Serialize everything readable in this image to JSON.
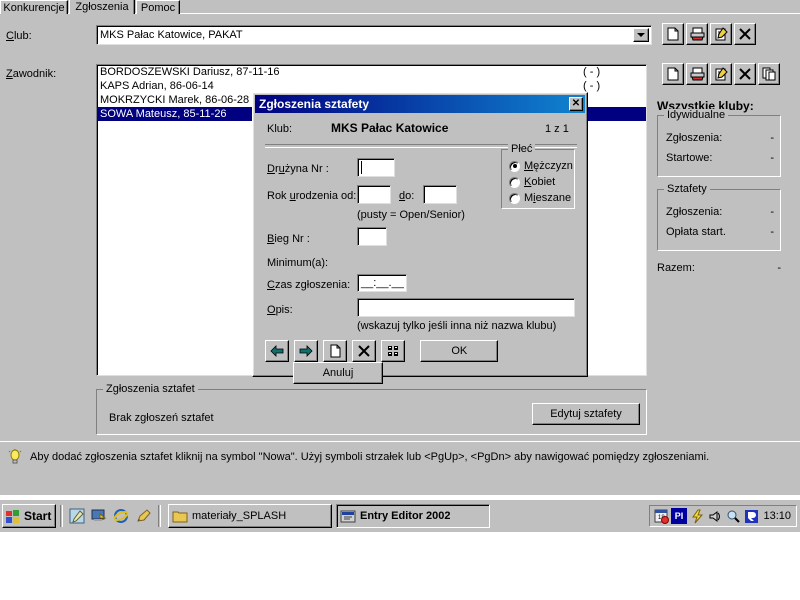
{
  "window": {
    "tabs": [
      {
        "label": "Konkurencje",
        "active": false
      },
      {
        "label": "Zgłoszenia",
        "active": true
      },
      {
        "label": "Pomoc",
        "active": false
      }
    ]
  },
  "form": {
    "club_label": "Club:",
    "club_value": "MKS Pałac Katowice,  PAKAT",
    "athlete_label": "Zawodnik:",
    "athletes": [
      {
        "name": "BORDOSZEWSKI Dariusz, 87-11-16",
        "mark": "( - )",
        "selected": false
      },
      {
        "name": "KAPS Adrian, 86-06-14",
        "mark": "( - )",
        "selected": false
      },
      {
        "name": "MOKRZYCKI Marek, 86-06-28",
        "mark": "",
        "selected": false
      },
      {
        "name": "SOWA Mateusz, 85-11-26",
        "mark": "",
        "selected": true
      }
    ]
  },
  "relay_section": {
    "group_title": "Zgłoszenia sztafet",
    "empty_text": "Brak zgłoszeń sztafet",
    "edit_button": "Edytuj sztafety"
  },
  "toolbar_top": [
    {
      "name": "new-icon",
      "title": "Nowa"
    },
    {
      "name": "print-icon",
      "title": "Drukuj"
    },
    {
      "name": "edit-icon",
      "title": "Edytuj"
    },
    {
      "name": "delete-icon",
      "title": "Usuń"
    }
  ],
  "toolbar_second": [
    {
      "name": "new-icon",
      "title": "Nowa"
    },
    {
      "name": "print-icon",
      "title": "Drukuj"
    },
    {
      "name": "edit-icon",
      "title": "Edytuj"
    },
    {
      "name": "delete-icon",
      "title": "Usuń"
    },
    {
      "name": "copy-icon",
      "title": "Kopiuj"
    }
  ],
  "side_panel": {
    "title": "Wszystkie kluby:",
    "individual": {
      "group_title": "Idywidualne",
      "rows": [
        {
          "label": "Zgłoszenia:",
          "value": "-"
        },
        {
          "label": "Startowe:",
          "value": "-"
        }
      ]
    },
    "relays": {
      "group_title": "Sztafety",
      "rows": [
        {
          "label": "Zgłoszenia:",
          "value": "-"
        },
        {
          "label": "Opłata start.",
          "value": "-"
        }
      ]
    },
    "total": {
      "label": "Razem:",
      "value": "-"
    }
  },
  "statusbar": {
    "icon": "lightbulb-icon",
    "text": "Aby dodać zgłoszenia sztafet kliknij na symbol \"Nowa\". Użyj symboli strzałek lub <PgUp>, <PgDn> aby nawigować pomiędzy zgłoszeniami."
  },
  "dialog": {
    "title": "Zgłoszenia sztafety",
    "close_label": "✕",
    "club_label": "Klub:",
    "club_value": "MKS Pałac Katowice",
    "counter": "1 z 1",
    "team_label": "Drużyna Nr :",
    "team_value": "",
    "birth_label": "Rok urodzenia od:",
    "birth_from": "",
    "birth_to_label": "do:",
    "birth_to": "",
    "birth_hint": "(pusty = Open/Senior)",
    "heat_label": "Bieg Nr :",
    "heat_value": "",
    "minimum_label": "Minimum(a):",
    "time_label": "Czas zgłoszenia:",
    "time_value": "__:__.__",
    "desc_label": "Opis:",
    "desc_value": "",
    "desc_hint": "(wskazuj tylko jeśli inna niż nazwa klubu)",
    "sex": {
      "group_title": "Płeć",
      "options": [
        {
          "label": "Mężczyzn",
          "selected": true
        },
        {
          "label": "Kobiet",
          "selected": false
        },
        {
          "label": "Mieszane",
          "selected": false
        }
      ]
    },
    "nav_buttons": [
      {
        "name": "previous-record-icon"
      },
      {
        "name": "next-record-icon"
      },
      {
        "name": "new-record-icon"
      },
      {
        "name": "delete-record-icon"
      },
      {
        "name": "team-members-icon"
      }
    ],
    "ok_label": "OK",
    "cancel_label": "Anuluj"
  },
  "taskbar": {
    "start_label": "Start",
    "quick_launch": [
      {
        "name": "notepad-icon"
      },
      {
        "name": "show-desktop-icon"
      },
      {
        "name": "internet-explorer-icon"
      },
      {
        "name": "pencil-icon"
      }
    ],
    "tasks": [
      {
        "label": "materiały_SPLASH",
        "icon": "folder-icon",
        "active": false
      },
      {
        "label": "Entry Editor 2002",
        "icon": "app-icon",
        "active": true
      }
    ],
    "tray": [
      {
        "name": "scheduler-icon"
      },
      {
        "name": "keyboard-language-icon",
        "label": "PI"
      },
      {
        "name": "power-icon"
      },
      {
        "name": "volume-icon"
      },
      {
        "name": "find-fast-icon"
      },
      {
        "name": "realplayer-icon"
      }
    ],
    "clock": "13:10"
  },
  "colors": {
    "face": "#c0c0c0",
    "selection": "#000080",
    "title_gradient_start": "#000080",
    "title_gradient_end": "#1084d0",
    "statusbar_text": "#000000"
  }
}
